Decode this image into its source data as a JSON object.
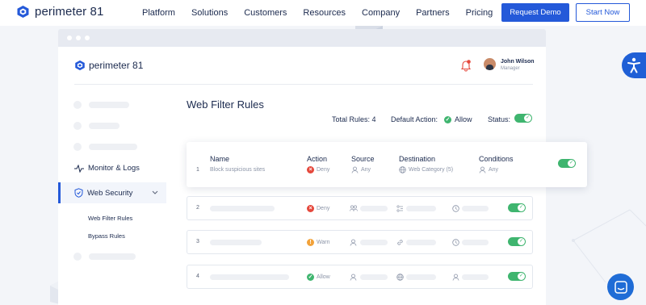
{
  "site": {
    "brand": "perimeter 81",
    "nav": [
      "Platform",
      "Solutions",
      "Customers",
      "Resources",
      "Company",
      "Partners",
      "Pricing"
    ],
    "request_demo": "Request Demo",
    "start_now": "Start Now"
  },
  "app": {
    "brand": "perimeter 81",
    "user_name": "John Wilson",
    "user_role": "Manager"
  },
  "sidebar": {
    "monitor": "Monitor & Logs",
    "web_security": "Web Security",
    "sub": [
      "Web Filter Rules",
      "Bypass Rules"
    ]
  },
  "main": {
    "title": "Web Filter Rules",
    "total_rules": "Total Rules: 4",
    "default_action_label": "Default Action:",
    "default_action_value": "Allow",
    "status_label": "Status:",
    "columns": [
      "Name",
      "Action",
      "Source",
      "Destination",
      "Conditions"
    ],
    "rows": [
      {
        "num": "1",
        "name": "Block suspicious sites",
        "action": "Deny",
        "source": "Any",
        "destination": "Web Category (5)",
        "conditions": "Any"
      },
      {
        "num": "2",
        "action": "Deny"
      },
      {
        "num": "3",
        "action": "Warn"
      },
      {
        "num": "4",
        "action": "Allow"
      }
    ]
  },
  "colors": {
    "brand_blue": "#2459d9",
    "deny": "#e5483c",
    "warn": "#f2a23a",
    "allow": "#3fb56f"
  },
  "icons": [
    "bell-icon",
    "chevron-down-icon",
    "shield-icon",
    "activity-icon",
    "users-icon",
    "globe-icon",
    "link-icon",
    "clock-icon",
    "check-icon",
    "accessibility-icon",
    "chat-icon"
  ]
}
